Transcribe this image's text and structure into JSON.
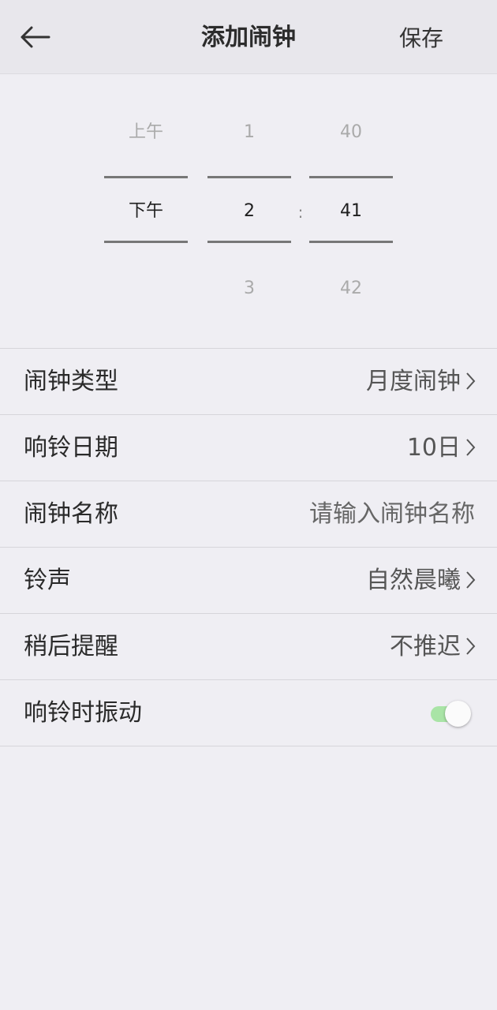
{
  "header": {
    "title": "添加闹钟",
    "save_label": "保存"
  },
  "picker": {
    "ampm": {
      "above": "上午",
      "selected": "下午",
      "below": ""
    },
    "hour": {
      "above": "1",
      "selected": "2",
      "below": "3"
    },
    "separator": ":",
    "minute": {
      "above": "40",
      "selected": "41",
      "below": "42"
    }
  },
  "settings": {
    "alarm_type": {
      "label": "闹钟类型",
      "value": "月度闹钟"
    },
    "ring_date": {
      "label": "响铃日期",
      "value": "10日"
    },
    "alarm_name": {
      "label": "闹钟名称",
      "placeholder": "请输入闹钟名称"
    },
    "ringtone": {
      "label": "铃声",
      "value": "自然晨曦"
    },
    "snooze": {
      "label": "稍后提醒",
      "value": "不推迟"
    },
    "vibrate": {
      "label": "响铃时振动",
      "enabled": true
    }
  },
  "colors": {
    "toggle_on": "#a9e4a6",
    "background": "#efeef3"
  }
}
